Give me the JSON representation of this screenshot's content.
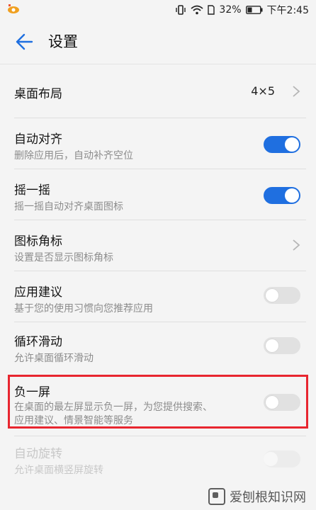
{
  "status_bar": {
    "battery_percent": "32%",
    "time": "下午2:45"
  },
  "header": {
    "title": "设置"
  },
  "settings": [
    {
      "label": "桌面布局",
      "subtitle": "",
      "value": "4×5",
      "control": "chevron"
    },
    {
      "label": "自动对齐",
      "subtitle": "删除应用后，自动补齐空位",
      "control": "toggle",
      "state": "on"
    },
    {
      "label": "摇一摇",
      "subtitle": "摇一摇自动对齐桌面图标",
      "control": "toggle",
      "state": "on"
    },
    {
      "label": "图标角标",
      "subtitle": "设置是否显示图标角标",
      "control": "chevron"
    },
    {
      "label": "应用建议",
      "subtitle": "基于您的使用习惯向您推荐应用",
      "control": "toggle",
      "state": "off"
    },
    {
      "label": "循环滑动",
      "subtitle": "允许桌面循环滑动",
      "control": "toggle",
      "state": "off"
    },
    {
      "label": "负一屏",
      "subtitle_line1": "在桌面的最左屏显示负一屏，为您提供搜索、",
      "subtitle_line2": "应用建议、情景智能等服务",
      "control": "toggle",
      "state": "off"
    },
    {
      "label": "自动旋转",
      "subtitle": "允许桌面横竖屏旋转",
      "control": "toggle",
      "state": "disabled"
    }
  ],
  "colors": {
    "toggle_on": "#1f6fe0",
    "highlight_box": "#e8262f",
    "accent_back": "#1f6fe0"
  },
  "watermark": {
    "text": "爱刨根知识网"
  }
}
